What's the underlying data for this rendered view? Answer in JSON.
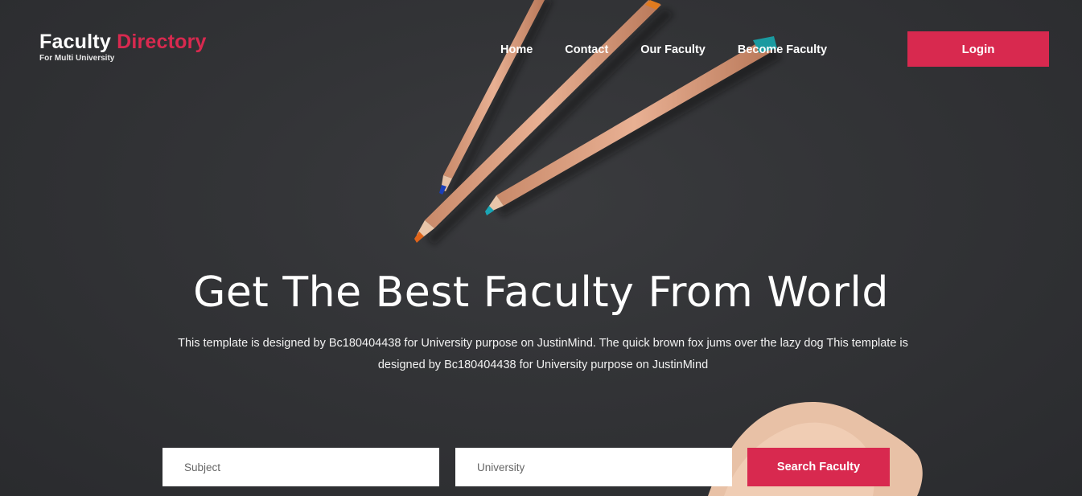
{
  "logo": {
    "word1": "Faculty",
    "word2": "Directory",
    "subtitle": "For Multi University"
  },
  "nav": {
    "items": [
      "Home",
      "Contact",
      "Our Faculty",
      "Become Faculty"
    ]
  },
  "header": {
    "login_label": "Login"
  },
  "hero": {
    "title": "Get The Best Faculty From World",
    "description": "This template is designed by Bc180404438 for University purpose on JustinMind. The quick brown fox jums over the lazy dog This template is designed by Bc180404438 for University purpose on JustinMind"
  },
  "search": {
    "subject_placeholder": "Subject",
    "university_placeholder": "University",
    "button_label": "Search Faculty"
  },
  "colors": {
    "accent": "#d8294f",
    "background": "#2f3033"
  }
}
